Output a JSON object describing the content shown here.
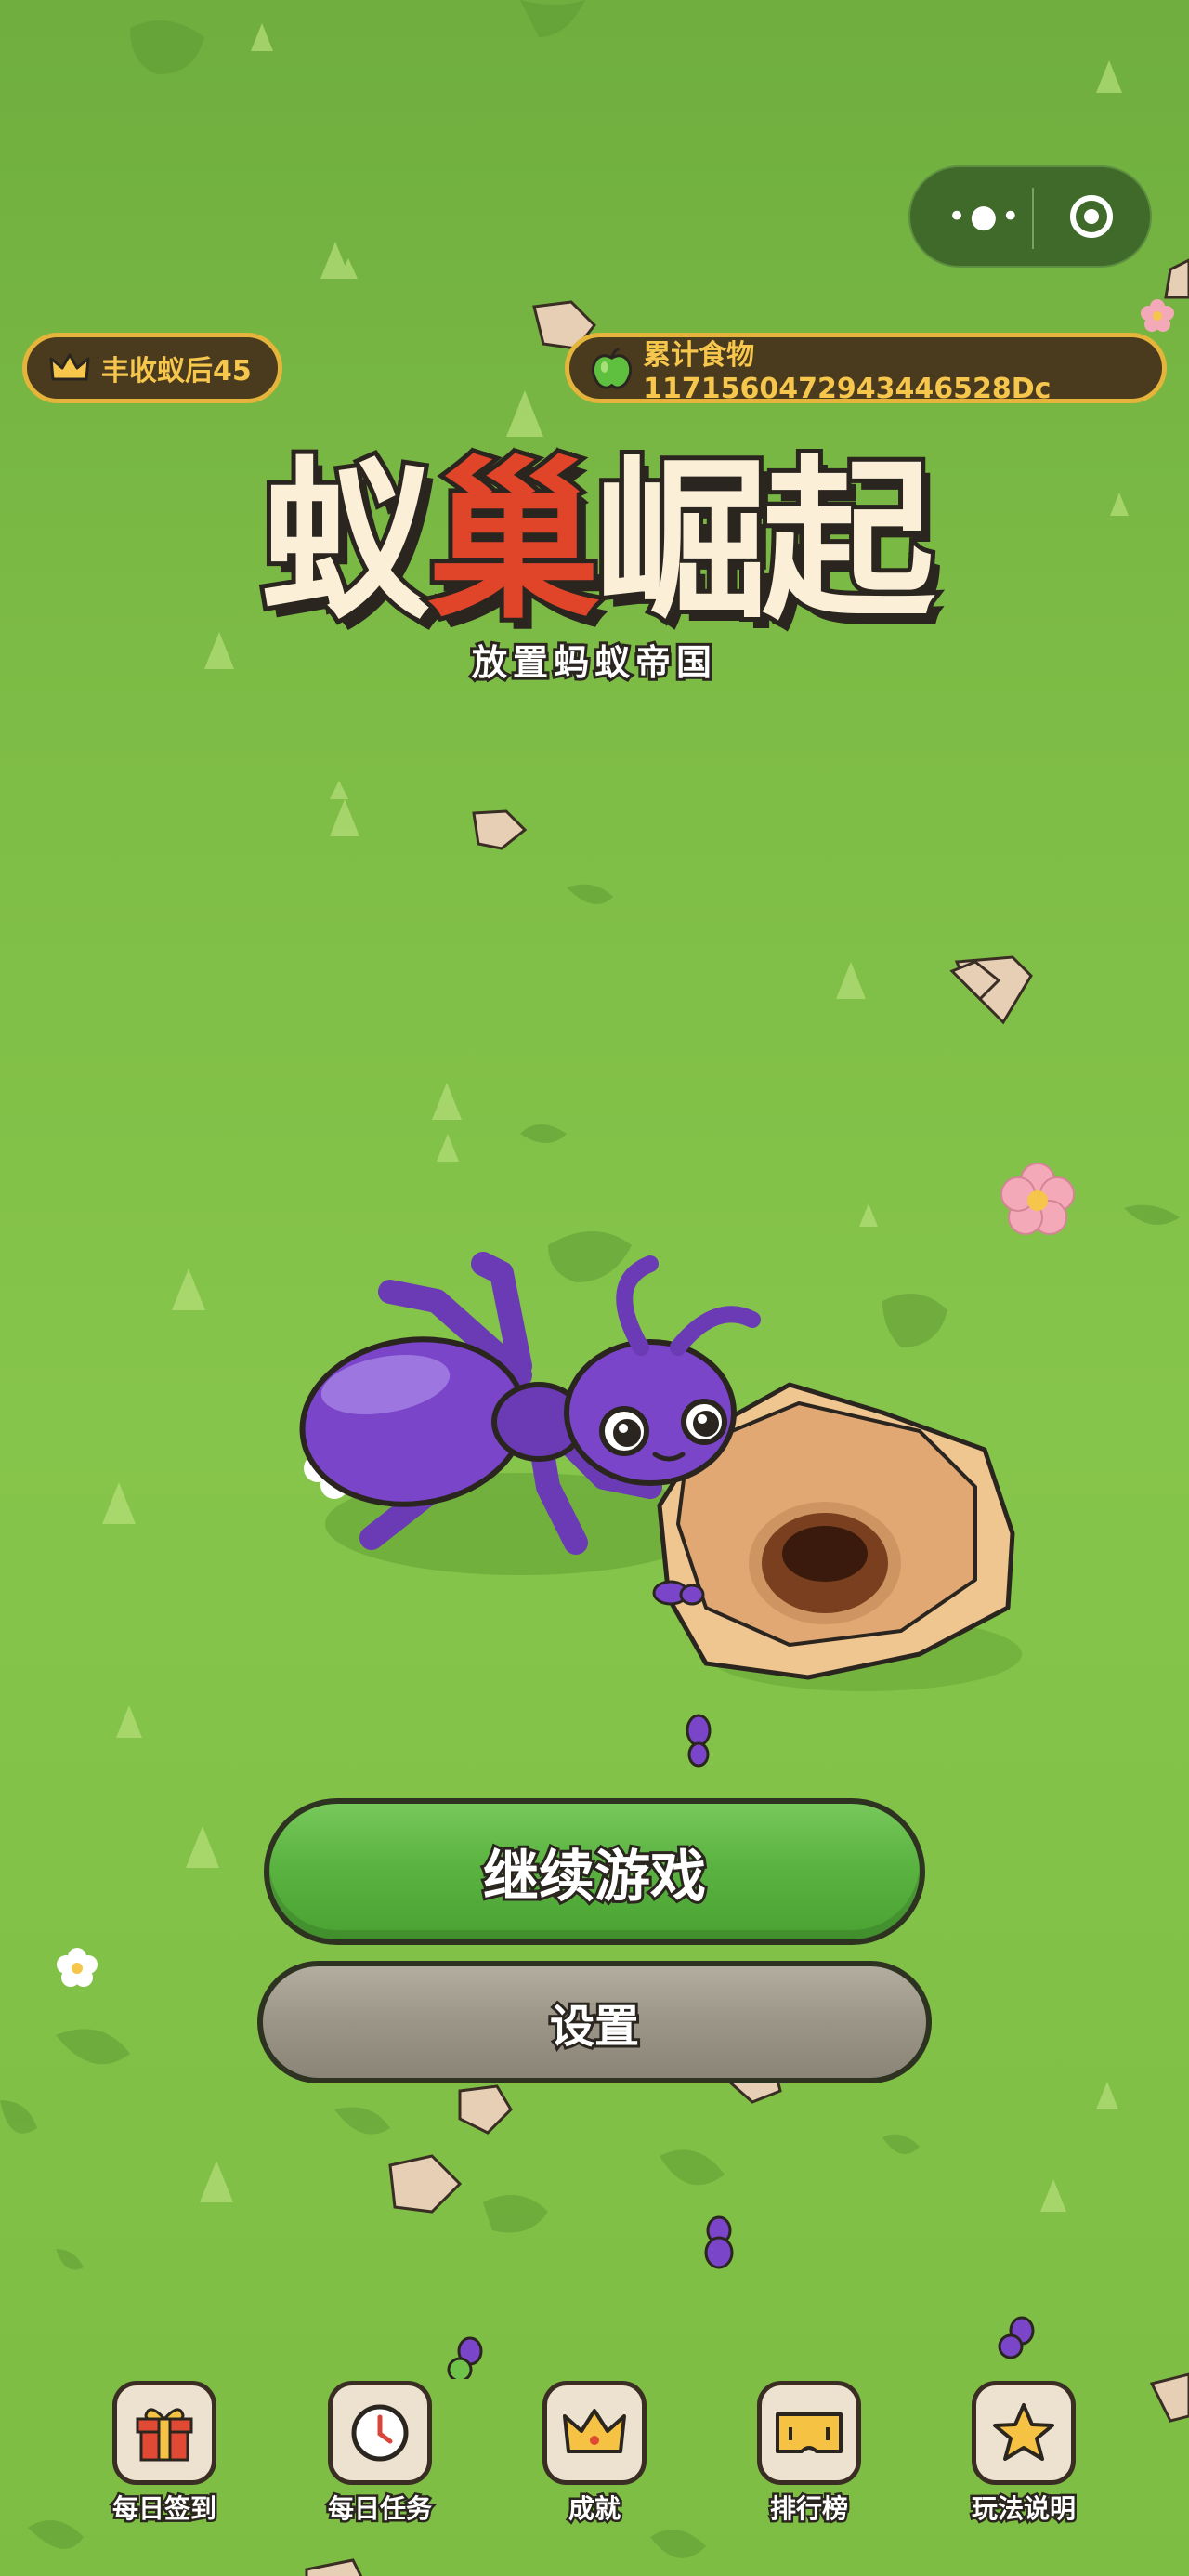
{
  "header": {
    "menu_icon": "more-dots-icon",
    "close_icon": "target-icon"
  },
  "stats": {
    "queen_label": "丰收蚁后45",
    "food_label": "累计食物 1171560472943446528Dc"
  },
  "title": {
    "part1": "蚁",
    "part2": "巢",
    "part3": "崛起",
    "subtitle": "放置蚂蚁帝国"
  },
  "buttons": {
    "continue": "继续游戏",
    "settings": "设置"
  },
  "nav": [
    {
      "label": "每日签到",
      "icon": "gift-icon"
    },
    {
      "label": "每日任务",
      "icon": "clock-icon"
    },
    {
      "label": "成就",
      "icon": "crown-icon"
    },
    {
      "label": "排行榜",
      "icon": "ticket-icon"
    },
    {
      "label": "玩法说明",
      "icon": "star-icon"
    }
  ],
  "colors": {
    "grass": "#7cbb45",
    "accent_gold": "#e4b43b",
    "title_red": "#e0452a",
    "ant_purple": "#7a45c9",
    "button_green": "#5bb341",
    "button_grey": "#9b9587"
  }
}
